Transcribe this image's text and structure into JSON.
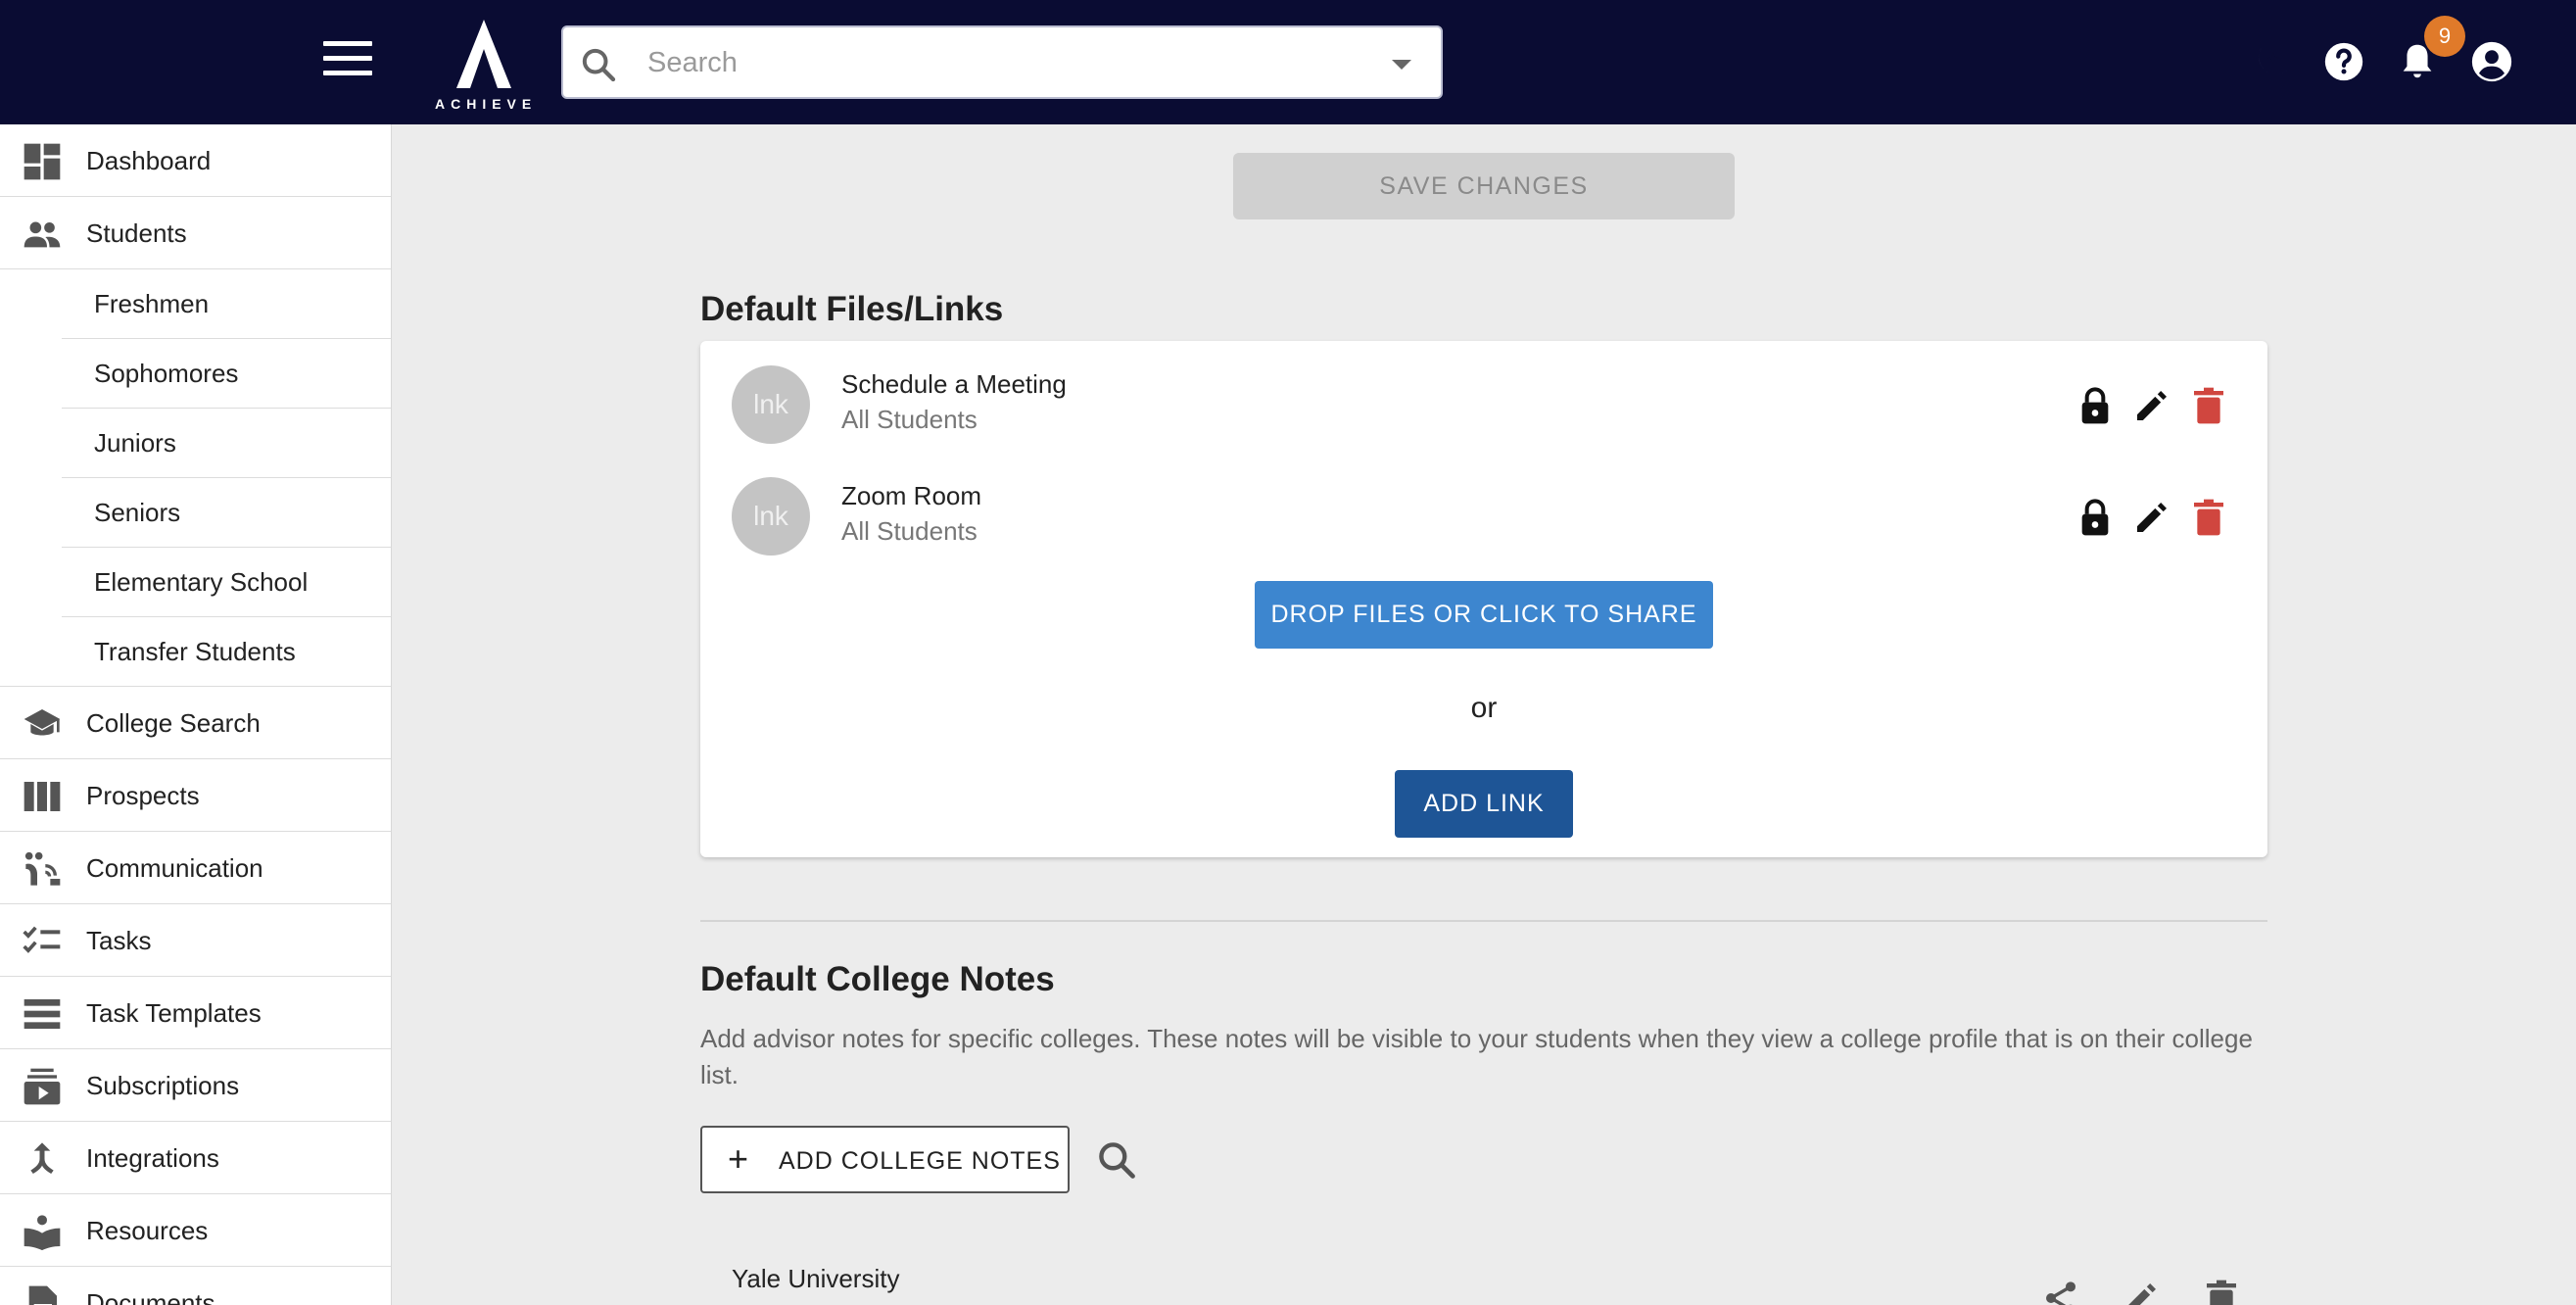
{
  "header": {
    "logo_text": "ACHIEVE",
    "search_placeholder": "Search",
    "notification_count": "9"
  },
  "sidebar": {
    "items": [
      {
        "label": "Dashboard",
        "icon": "dashboard-icon"
      },
      {
        "label": "Students",
        "icon": "people-icon"
      },
      {
        "label": "College Search",
        "icon": "school-icon"
      },
      {
        "label": "Prospects",
        "icon": "columns-icon"
      },
      {
        "label": "Communication",
        "icon": "communication-icon"
      },
      {
        "label": "Tasks",
        "icon": "checklist-icon"
      },
      {
        "label": "Task Templates",
        "icon": "list-icon"
      },
      {
        "label": "Subscriptions",
        "icon": "subscriptions-icon"
      },
      {
        "label": "Integrations",
        "icon": "merge-icon"
      },
      {
        "label": "Resources",
        "icon": "book-icon"
      },
      {
        "label": "Documents",
        "icon": "document-icon"
      }
    ],
    "students_sub": [
      "Freshmen",
      "Sophomores",
      "Juniors",
      "Seniors",
      "Elementary School",
      "Transfer Students"
    ]
  },
  "main": {
    "save_label": "SAVE CHANGES",
    "files_title": "Default Files/Links",
    "files": [
      {
        "avatar": "lnk",
        "title": "Schedule a Meeting",
        "audience": "All Students"
      },
      {
        "avatar": "lnk",
        "title": "Zoom Room",
        "audience": "All Students"
      }
    ],
    "drop_label": "DROP FILES OR CLICK TO SHARE",
    "or_text": "or",
    "add_link_label": "ADD LINK",
    "notes_title": "Default College Notes",
    "notes_desc": "Add advisor notes for specific colleges. These notes will be visible to your students when they view a college profile that is on their college list.",
    "add_notes_label": "ADD COLLEGE NOTES",
    "add_notes_plus": "+",
    "colleges": [
      {
        "name": "Yale University"
      }
    ]
  },
  "colors": {
    "topbar": "#0a0c33",
    "primary_blue": "#3d86cf",
    "dark_blue": "#1e5596",
    "delete_red": "#d0463f",
    "badge_orange": "#e07a2a"
  }
}
